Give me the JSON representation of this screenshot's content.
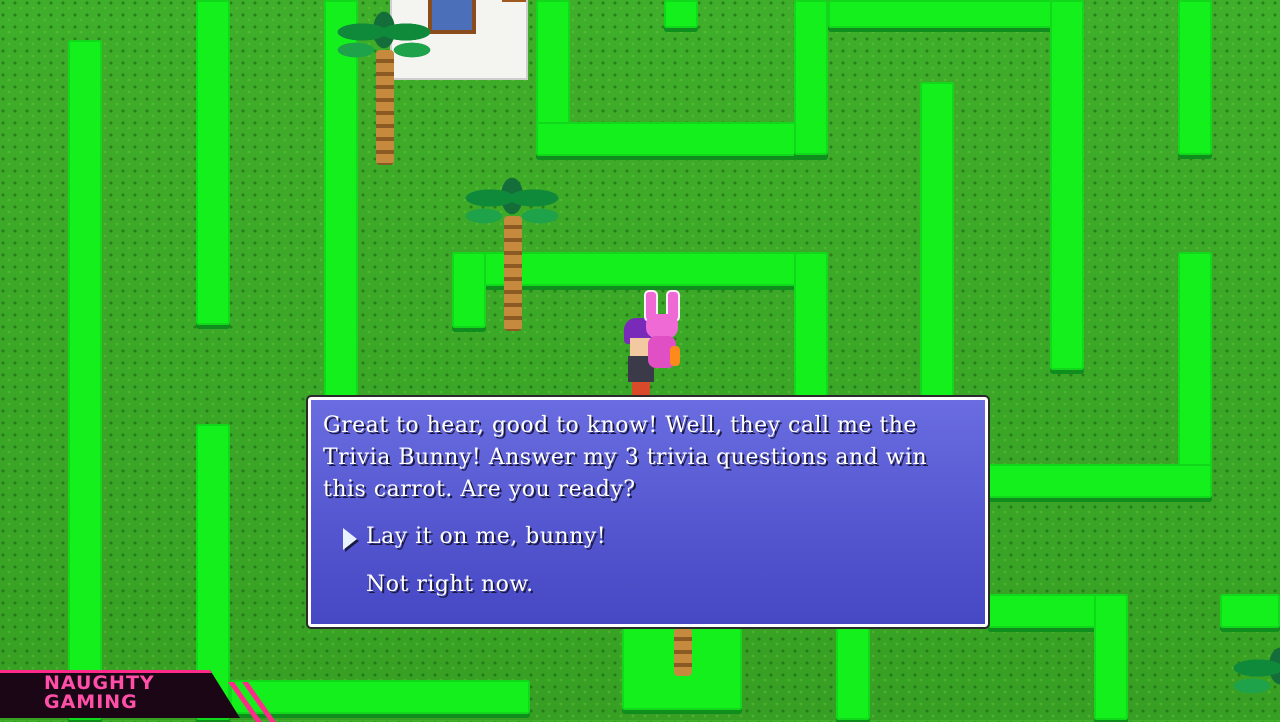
{
  "dialog": {
    "message": "Great to hear, good to know! Well, they call me the Trivia Bunny! Answer my 3 trivia questions and win this carrot. Are you ready?",
    "choices": [
      {
        "label": "Lay it on me, bunny!",
        "selected": true
      },
      {
        "label": "Not right now.",
        "selected": false
      }
    ]
  },
  "watermark": {
    "line1": "NAUGHTY",
    "line2": "GAMING"
  },
  "colors": {
    "grass": "#3aa526",
    "hedge": "#14f01c",
    "dialog_bg": "#5557d0",
    "dialog_border": "#ffffff",
    "watermark_accent": "#ff2a8a"
  },
  "characters": [
    "player",
    "trivia-bunny"
  ]
}
